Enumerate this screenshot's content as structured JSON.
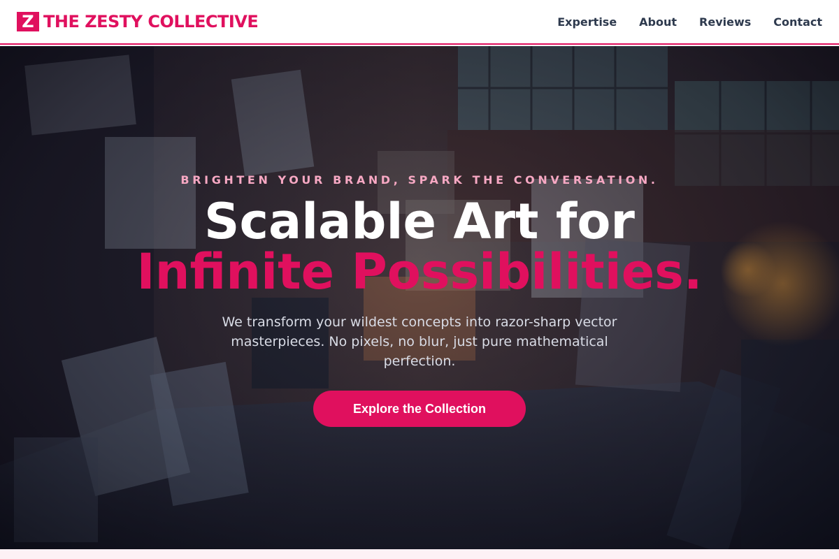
{
  "brand": {
    "logo_mark": "Z",
    "name": "THE ZESTY COLLECTIVE",
    "accent_color": "#e0105e"
  },
  "nav": {
    "items": [
      {
        "label": "Expertise"
      },
      {
        "label": "About"
      },
      {
        "label": "Reviews"
      },
      {
        "label": "Contact"
      }
    ]
  },
  "hero": {
    "tagline": "BRIGHTEN YOUR BRAND, SPARK THE CONVERSATION.",
    "headline_line1": "Scalable Art for",
    "headline_line2": "Infinite Possibilities.",
    "subtext": "We transform your wildest concepts into razor-sharp vector masterpieces. No pixels, no blur, just pure mathematical perfection.",
    "cta_label": "Explore the Collection",
    "background_image": "art-studio-photo"
  }
}
